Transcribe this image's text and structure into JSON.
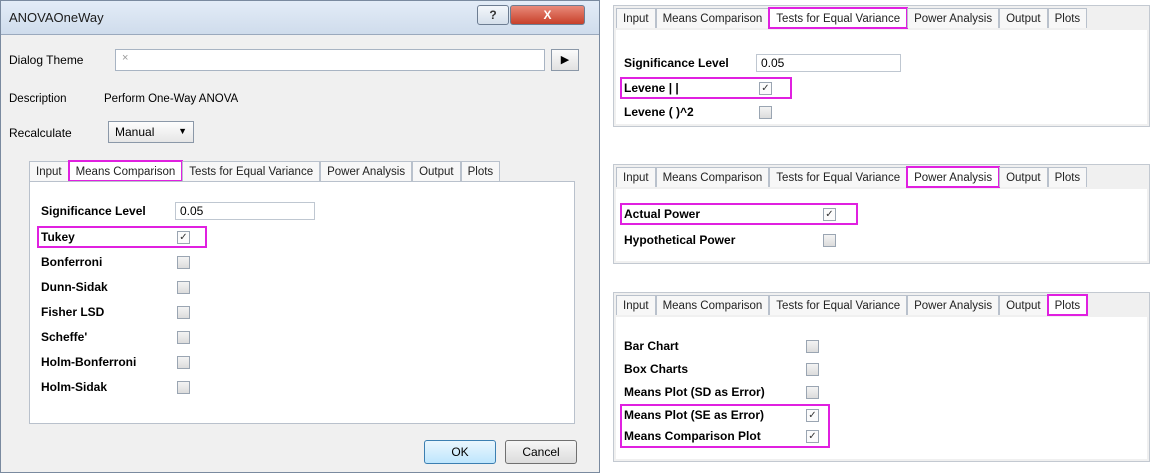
{
  "dialog": {
    "title": "ANOVAOneWay",
    "help_label": "?",
    "close_label": "X",
    "theme_label": "Dialog Theme",
    "theme_value": "×",
    "theme_arrow": "▶",
    "description_label": "Description",
    "description_value": "Perform One-Way ANOVA",
    "recalc_label": "Recalculate",
    "recalc_value": "Manual",
    "recalc_caret": "▼",
    "ok_label": "OK",
    "cancel_label": "Cancel"
  },
  "tabs": [
    "Input",
    "Means Comparison",
    "Tests for Equal Variance",
    "Power Analysis",
    "Output",
    "Plots"
  ],
  "means_comparison": {
    "sig_label": "Significance Level",
    "sig_value": "0.05",
    "items": [
      {
        "label": "Tukey",
        "checked": "✓"
      },
      {
        "label": "Bonferroni",
        "checked": ""
      },
      {
        "label": "Dunn-Sidak",
        "checked": ""
      },
      {
        "label": "Fisher LSD",
        "checked": ""
      },
      {
        "label": "Scheffe'",
        "checked": ""
      },
      {
        "label": "Holm-Bonferroni",
        "checked": ""
      },
      {
        "label": "Holm-Sidak",
        "checked": ""
      }
    ]
  },
  "equal_variance": {
    "sig_label": "Significance Level",
    "sig_value": "0.05",
    "items": [
      {
        "label": "Levene  |  |",
        "checked": "✓"
      },
      {
        "label": "Levene  (  )^2",
        "checked": ""
      }
    ]
  },
  "power_analysis": {
    "items": [
      {
        "label": "Actual Power",
        "checked": "✓"
      },
      {
        "label": "Hypothetical Power",
        "checked": ""
      }
    ]
  },
  "plots": {
    "items": [
      {
        "label": "Bar Chart",
        "checked": ""
      },
      {
        "label": "Box Charts",
        "checked": ""
      },
      {
        "label": "Means Plot (SD as Error)",
        "checked": ""
      },
      {
        "label": "Means Plot (SE as Error)",
        "checked": "✓"
      },
      {
        "label": "Means Comparison Plot",
        "checked": "✓"
      }
    ]
  },
  "colors": {
    "highlight": "#e020e0",
    "title_bg": "#cfdcec",
    "close_red": "#c7402a"
  }
}
